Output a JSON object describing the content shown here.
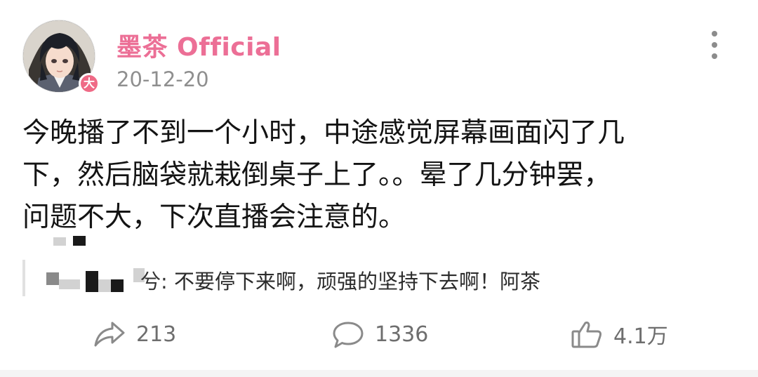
{
  "post": {
    "author": "墨茶 Official",
    "author_badge": "大",
    "date": "20-12-20",
    "content_lines": [
      "今晚播了不到一个小时，中途感觉屏幕画面闪了几",
      "下，然后脑袋就栽倒桌子上了。。晕了几分钟罢，",
      "问题不大，下次直播会注意的。"
    ]
  },
  "quote": {
    "name_visible": "兮:",
    "text": "不要停下来啊，顽强的坚持下去啊！阿茶"
  },
  "actions": {
    "share_count": "213",
    "comment_count": "1336",
    "like_count": "4.1万"
  },
  "icons": {
    "more": "more-vertical-icon",
    "share": "share-icon",
    "comment": "comment-icon",
    "like": "thumbs-up-icon"
  },
  "colors": {
    "author": "#ec6f96",
    "badge": "#ef6a86",
    "muted": "#8f8f8f"
  }
}
